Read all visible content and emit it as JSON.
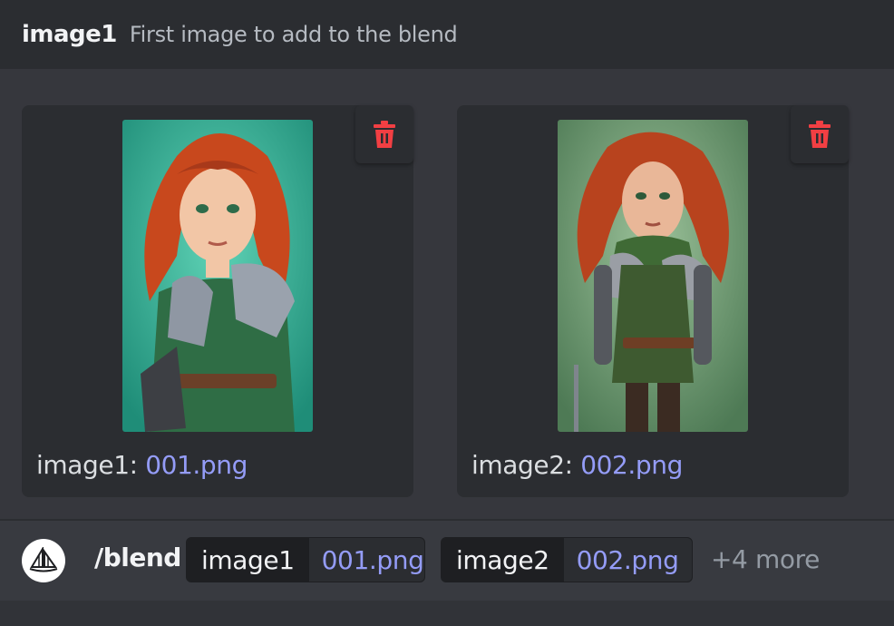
{
  "option": {
    "name": "image1",
    "description": "First image to add to the blend"
  },
  "attachments": [
    {
      "label": "image1:",
      "filename": "001.png",
      "delete_icon": "trash-icon"
    },
    {
      "label": "image2:",
      "filename": "002.png",
      "delete_icon": "trash-icon"
    }
  ],
  "command": {
    "bot_icon": "midjourney-boat-icon",
    "name": "/blend",
    "params": [
      {
        "key": "image1",
        "value": "001.png"
      },
      {
        "key": "image2",
        "value": "002.png"
      }
    ],
    "more": "+4 more"
  },
  "colors": {
    "link": "#949cf7",
    "danger": "#f23f43",
    "panel": "#2b2d31",
    "background": "#36373d"
  }
}
